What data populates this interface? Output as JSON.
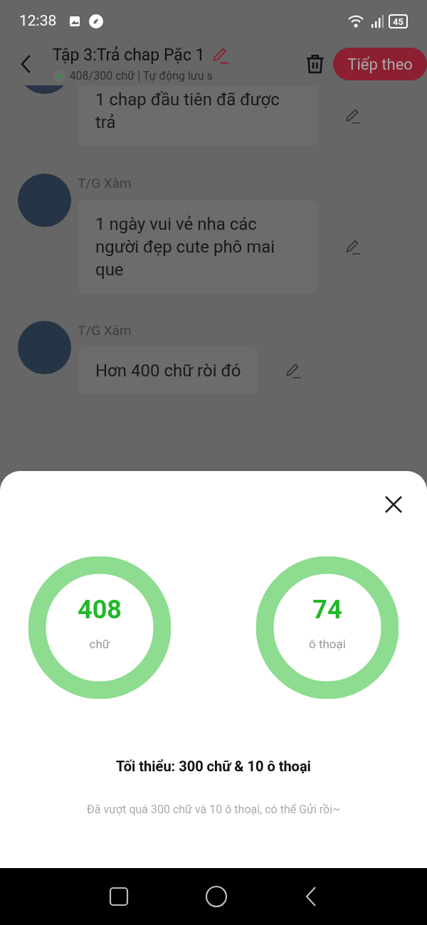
{
  "status_bar": {
    "time": "12:38",
    "battery": "45"
  },
  "header": {
    "title": "Tập 3:Trả chap Pặc 1",
    "subtitle": "408/300 chữ | Tự động lưu s",
    "saved": true,
    "next_button": "Tiếp theo"
  },
  "messages": [
    {
      "text": "1 chap đầu tiên đã được trả"
    },
    {
      "author": "T/G Xàm",
      "text": "1 ngày vui vẻ nha các người đẹp cute phô mai que"
    },
    {
      "author": "T/G Xàm",
      "text": "Hơn 400 chữ ròi đó"
    }
  ],
  "sheet": {
    "stats": [
      {
        "value": "408",
        "label": "chữ"
      },
      {
        "value": "74",
        "label": "ô thoại"
      }
    ],
    "minimum": "Tối thiểu: 300 chữ & 10 ô thoại",
    "hint": "Đã vượt quá 300 chữ và 10 ô thoại, có thể Gửi rồi~"
  }
}
